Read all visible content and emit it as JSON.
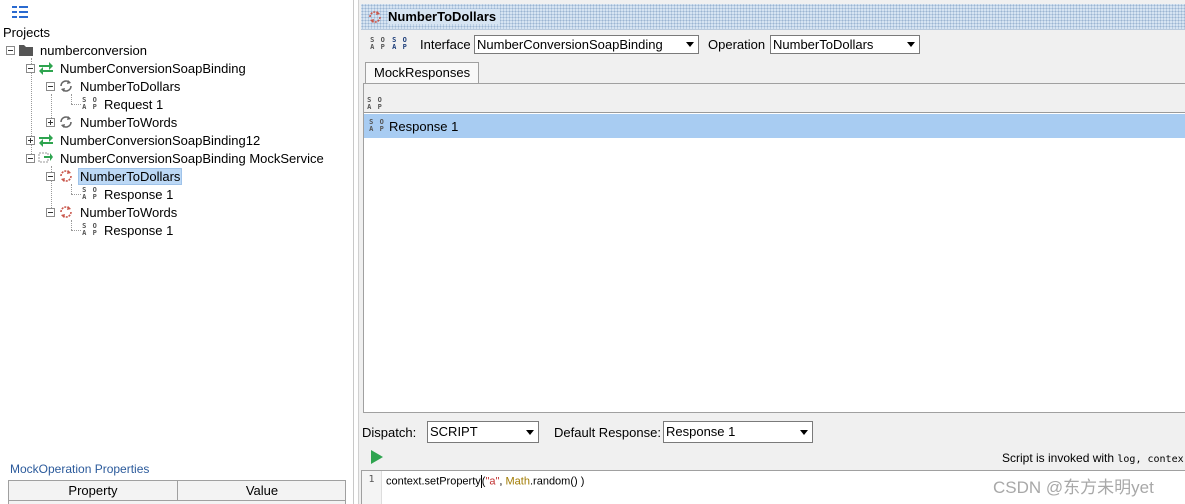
{
  "navigator": {
    "projects_label": "Projects",
    "tree": {
      "project": "numberconversion",
      "binding1": "NumberConversionSoapBinding",
      "op1": "NumberToDollars",
      "request1": "Request 1",
      "op2": "NumberToWords",
      "binding2": "NumberConversionSoapBinding12",
      "mock": "NumberConversionSoapBinding MockService",
      "mock_op1": "NumberToDollars",
      "mock_resp1": "Response 1",
      "mock_op2": "NumberToWords",
      "mock_resp2": "Response 1"
    },
    "properties": {
      "title": "MockOperation Properties",
      "col_property": "Property",
      "col_value": "Value"
    }
  },
  "editor": {
    "title": "NumberToDollars",
    "interface_label": "Interface",
    "interface_value": "NumberConversionSoapBinding",
    "operation_label": "Operation",
    "operation_value": "NumberToDollars",
    "tab_label": "MockResponses",
    "responses": [
      "Response 1"
    ],
    "dispatch_label": "Dispatch:",
    "dispatch_value": "SCRIPT",
    "default_response_label": "Default Response:",
    "default_response_value": "Response 1",
    "script_info_prefix": "Script is invoked with",
    "script_info_vars": "log, contex",
    "line_number": "1",
    "code": {
      "part1": "context.setProperty",
      "part2": "(",
      "str": "\"a\"",
      "part3": ", ",
      "cls": "Math",
      "part4": ".random",
      "part5": "() )"
    }
  },
  "watermark": "CSDN @东方未明yet",
  "colors": {
    "selection": "#a8ccf2",
    "tree_selection": "#bcd8f5",
    "interface_green": "#2ea44f",
    "title_bar": "#d6e4f2",
    "props_title": "#2b5a9b"
  }
}
